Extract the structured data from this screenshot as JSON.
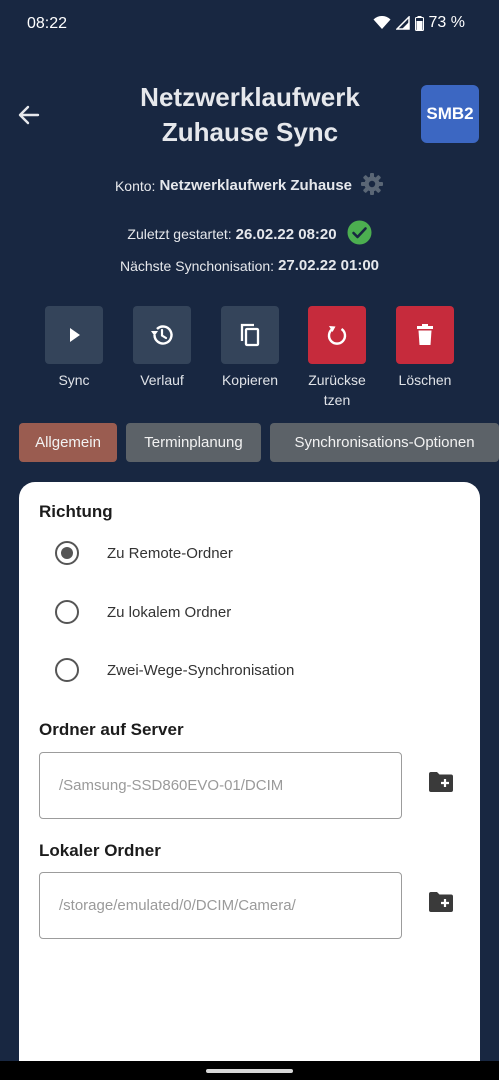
{
  "status": {
    "time": "08:22",
    "battery": "73 %"
  },
  "header": {
    "title_line1": "Netzwerklaufwerk",
    "title_line2": "Zuhause Sync",
    "badge": "SMB2"
  },
  "info": {
    "account_label": "Konto:",
    "account_value": "Netzwerklaufwerk Zuhause",
    "last_started_label": "Zuletzt gestartet:",
    "last_started_value": "26.02.22 08:20",
    "next_sync_label": "Nächste Synchonisation:",
    "next_sync_value": "27.02.22 01:00"
  },
  "actions": [
    {
      "label": "Sync",
      "icon": "play-icon"
    },
    {
      "label": "Verlauf",
      "icon": "history-icon"
    },
    {
      "label": "Kopieren",
      "icon": "copy-icon"
    },
    {
      "label": "Zurückse\ntzen",
      "icon": "reset-icon"
    },
    {
      "label": "Löschen",
      "icon": "trash-icon"
    }
  ],
  "tabs": [
    {
      "label": "Allgemein",
      "active": true
    },
    {
      "label": "Terminplanung",
      "active": false
    },
    {
      "label": "Synchronisations-Optionen",
      "active": false
    }
  ],
  "direction": {
    "title": "Richtung",
    "options": [
      {
        "label": "Zu Remote-Ordner",
        "selected": true
      },
      {
        "label": "Zu lokalem Ordner",
        "selected": false
      },
      {
        "label": "Zwei-Wege-Synchronisation",
        "selected": false
      }
    ]
  },
  "server_folder": {
    "title": "Ordner auf Server",
    "placeholder": "/Samsung-SSD860EVO-01/DCIM"
  },
  "local_folder": {
    "title": "Lokaler Ordner",
    "placeholder": "/storage/emulated/0/DCIM/Camera/"
  },
  "colors": {
    "background": "#182741",
    "accent_red": "#c62b3c",
    "tab_active": "#9a5c50",
    "badge_blue": "#3c67c2",
    "success_green": "#4caf50"
  }
}
